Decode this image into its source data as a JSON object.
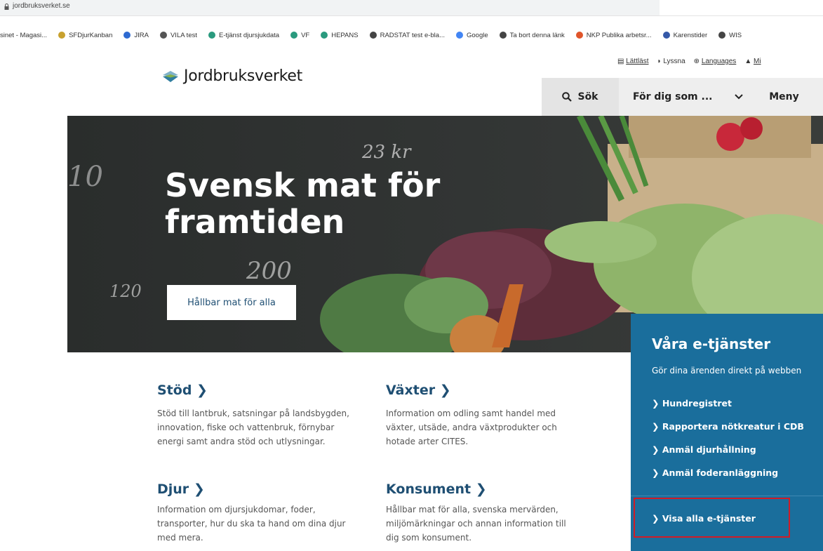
{
  "browser": {
    "url": "jordbruksverket.se",
    "bookmarks": [
      {
        "label": "sinet - Magasi...",
        "icon": "none",
        "color": ""
      },
      {
        "label": "SFDjurKanban",
        "icon": "kanban-icon",
        "color": "#c8a12e"
      },
      {
        "label": "JIRA",
        "icon": "jira-icon",
        "color": "#2e6ad1"
      },
      {
        "label": "VILA test",
        "icon": "xb-icon",
        "color": "#555555"
      },
      {
        "label": "E-tjänst djursjukdata",
        "icon": "diamond-icon",
        "color": "#2a9a7e"
      },
      {
        "label": "VF",
        "icon": "diamond-icon",
        "color": "#2a9a7e"
      },
      {
        "label": "HEPANS",
        "icon": "diamond-icon",
        "color": "#2a9a7e"
      },
      {
        "label": "RADSTAT test e-bla...",
        "icon": "globe-icon",
        "color": "#444444"
      },
      {
        "label": "Google",
        "icon": "google-icon",
        "color": "#4285f4"
      },
      {
        "label": "Ta bort denna länk",
        "icon": "globe-icon",
        "color": "#444444"
      },
      {
        "label": "NKP Publika arbetsr...",
        "icon": "circle-icon",
        "color": "#e0552a"
      },
      {
        "label": "Karenstider",
        "icon": "leaf-icon",
        "color": "#3559a8"
      },
      {
        "label": "WIS",
        "icon": "globe-icon",
        "color": "#444444"
      }
    ]
  },
  "site": {
    "logo_text": "Jordbruksverket",
    "topnav": {
      "easy": "Lättläst",
      "listen": "Lyssna",
      "languages": "Languages",
      "my": "Mi"
    },
    "nav": {
      "search": "Sök",
      "audience": "För dig som ...",
      "menu": "Meny"
    }
  },
  "hero": {
    "title_line1": "Svensk mat för",
    "title_line2": "framtiden",
    "button": "Hållbar mat för alla",
    "chalk_notes": [
      "23 kr",
      "200",
      "120",
      "10"
    ]
  },
  "categories": [
    {
      "title": "Stöd",
      "desc": [
        "Stöd till lantbruk, satsningar på landsbygden,",
        "innovation, fiske och vattenbruk, förnybar",
        "energi samt andra stöd och utlysningar."
      ]
    },
    {
      "title": "Växter",
      "desc": [
        "Information om odling samt handel med",
        "växter, utsäde, andra växtprodukter och",
        "hotade arter CITES."
      ]
    },
    {
      "title": "Djur",
      "desc": [
        "Information om djursjukdomar, foder,",
        "transporter, hur du ska ta hand om dina djur",
        "med mera."
      ]
    },
    {
      "title": "Konsument",
      "desc": [
        "Hållbar mat för alla, svenska mervärden,",
        "miljömärkningar och annan information till",
        "dig som konsument."
      ]
    }
  ],
  "eservices": {
    "title": "Våra e-tjänster",
    "subtitle": "Gör dina ärenden direkt på webben",
    "links": [
      "Hundregistret",
      "Rapportera nötkreatur i CDB",
      "Anmäl djurhållning",
      "Anmäl foderanläggning"
    ],
    "all": "Visa alla e-tjänster"
  },
  "colors": {
    "brand_blue": "#1f4f73",
    "panel_blue": "#1a6e9c",
    "highlight_red": "#d11b26"
  }
}
